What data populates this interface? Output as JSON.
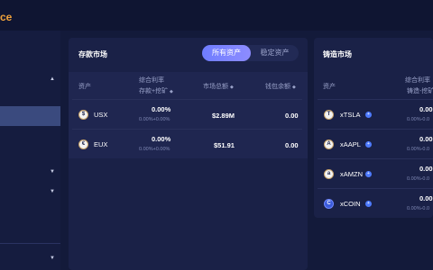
{
  "header": {
    "brand_fragment": "ce"
  },
  "deposit": {
    "title": "存款市场",
    "tabs": {
      "all": "所有资产",
      "stable": "稳定资产"
    },
    "columns": {
      "asset": "资产",
      "rate_top": "综合利率",
      "rate_bottom": "存款+挖矿",
      "total": "市场总额",
      "wallet": "钱包余额"
    },
    "rows": [
      {
        "icon": "$",
        "symbol": "USX",
        "rate": "0.00%",
        "rate_detail": "0.00%+0.00%",
        "total": "$2.89M",
        "wallet": "0.00"
      },
      {
        "icon": "€",
        "symbol": "EUX",
        "rate": "0.00%",
        "rate_detail": "0.00%+0.00%",
        "total": "$51.91",
        "wallet": "0.00"
      }
    ]
  },
  "mint": {
    "title": "铸造市场",
    "columns": {
      "asset": "资产",
      "rate_top": "综合利率",
      "rate_bottom": "铸造-挖矿"
    },
    "rows": [
      {
        "icon": "T",
        "symbol": "xTSLA",
        "rate": "0.00",
        "rate_detail": "0.00%-0.0"
      },
      {
        "icon": "A",
        "symbol": "xAAPL",
        "rate": "0.00",
        "rate_detail": "0.00%-0.0"
      },
      {
        "icon": "a",
        "symbol": "xAMZN",
        "rate": "0.00",
        "rate_detail": "0.00%-0.0"
      },
      {
        "icon": "C",
        "symbol": "xCOIN",
        "rate": "0.00",
        "rate_detail": "0.00%-0.0"
      }
    ]
  },
  "colors": {
    "accent": "#6f7dff",
    "brand": "#f0a23b",
    "bg": "#131a3a"
  }
}
